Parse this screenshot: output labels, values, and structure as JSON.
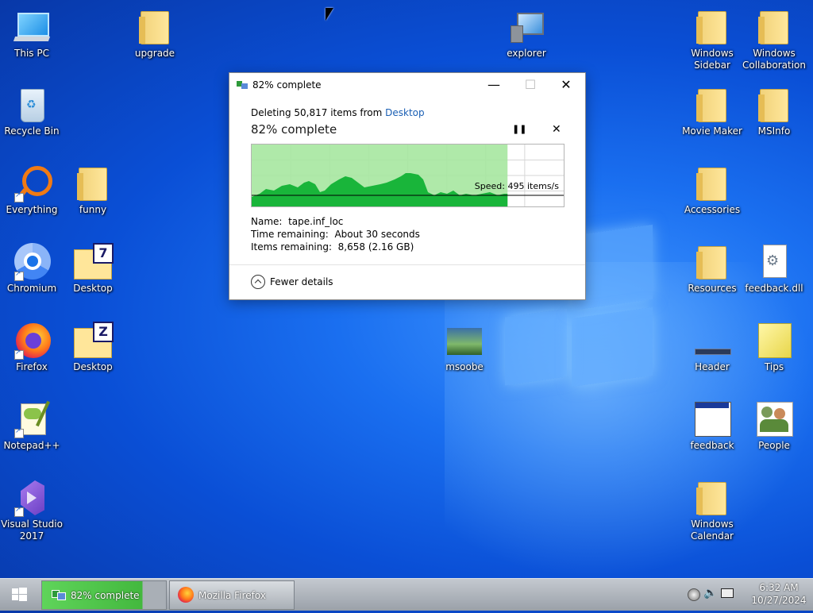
{
  "desktop": {
    "icons": [
      {
        "label": "This PC"
      },
      {
        "label": "Recycle Bin"
      },
      {
        "label": "Everything"
      },
      {
        "label": "Chromium"
      },
      {
        "label": "Firefox"
      },
      {
        "label": "Notepad++"
      },
      {
        "label": "Visual Studio\n2017"
      },
      {
        "label": "upgrade"
      },
      {
        "label": "funny"
      },
      {
        "label": "Desktop"
      },
      {
        "label": "Desktop"
      },
      {
        "label": "explorer"
      },
      {
        "label": "msoobe"
      },
      {
        "label": "Windows\nSidebar"
      },
      {
        "label": "Windows\nCollaboration"
      },
      {
        "label": "Movie Maker"
      },
      {
        "label": "MSInfo"
      },
      {
        "label": "Accessories"
      },
      {
        "label": "Resources"
      },
      {
        "label": "feedback.dll"
      },
      {
        "label": "Header"
      },
      {
        "label": "Tips"
      },
      {
        "label": "feedback"
      },
      {
        "label": "People"
      },
      {
        "label": "Windows\nCalendar"
      }
    ]
  },
  "dialog": {
    "title": "82% complete",
    "deleting_prefix": "Deleting 50,817 items from ",
    "deleting_link": "Desktop",
    "percent_text": "82% complete",
    "progress": 0.82,
    "speed": "Speed: 495 items/s",
    "name_label": "Name:",
    "name_value": "tape.inf_loc",
    "time_label": "Time remaining:",
    "time_value": "About 30 seconds",
    "items_label": "Items remaining:",
    "items_value": "8,658 (2.16 GB)",
    "fewer_details": "Fewer details",
    "pause_glyph": "❚❚",
    "stop_glyph": "✕",
    "minimize_glyph": "—",
    "maximize_glyph": "☐",
    "close_glyph": "✕",
    "accent": "#1a5fb4",
    "progress_color": "#a6e7a0",
    "graph_color": "#19b53a"
  },
  "taskbar": {
    "tasks": [
      {
        "label": "82% complete"
      },
      {
        "label": "Mozilla Firefox"
      }
    ],
    "time": "6:32 AM",
    "date": "10/27/2024"
  }
}
